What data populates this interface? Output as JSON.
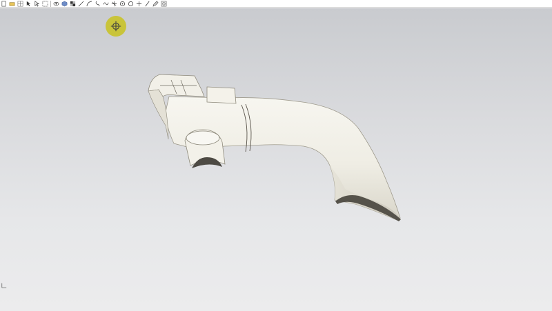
{
  "toolbar": {
    "buttons": [
      {
        "icon": "new-file-icon"
      },
      {
        "icon": "open-file-icon"
      },
      {
        "icon": "grid-icon"
      },
      {
        "icon": "select-arrow-icon"
      },
      {
        "icon": "wireframe-arrow-icon"
      },
      {
        "icon": "box-select-icon"
      },
      {
        "icon": "eye-icon"
      },
      {
        "icon": "shaded-cube-icon"
      },
      {
        "icon": "checker-icon"
      },
      {
        "icon": "line-icon"
      },
      {
        "icon": "arc-icon"
      },
      {
        "icon": "curve-icon"
      },
      {
        "icon": "spline-icon"
      },
      {
        "icon": "trim-icon"
      },
      {
        "icon": "circle-point-icon"
      },
      {
        "icon": "circle-icon"
      },
      {
        "icon": "plus-icon"
      },
      {
        "icon": "slash-icon"
      },
      {
        "icon": "edit-icon"
      },
      {
        "icon": "settings-box-icon"
      }
    ]
  },
  "viewport": {
    "background_top": "#c9cbcf",
    "background_bottom": "#ececed",
    "model_color": "#f1efe6",
    "cursor_marker_color": "#c9c42e",
    "model_name": "curved-duct-part-icon"
  }
}
